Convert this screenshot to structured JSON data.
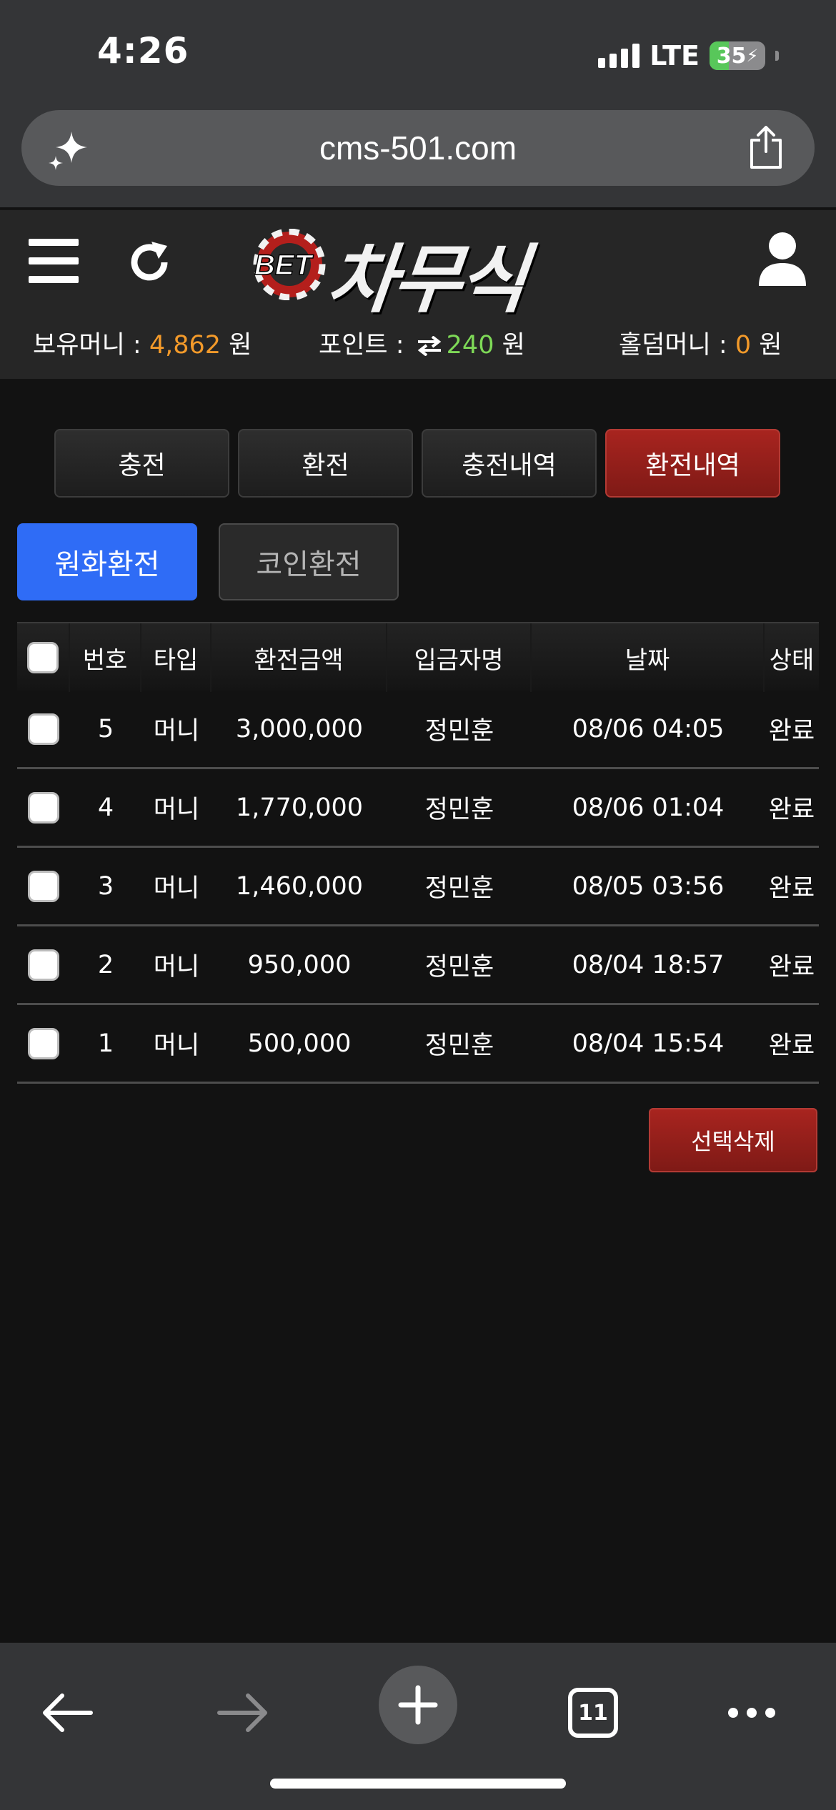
{
  "status_bar": {
    "time": "4:26",
    "network": "LTE",
    "battery": "35",
    "battery_level": 0.35
  },
  "browser": {
    "url": "cms-501.com",
    "tab_count": "11"
  },
  "site": {
    "logo_text": "차무식",
    "logo_badge": "BET",
    "balances": {
      "money_label": "보유머니 : ",
      "money_value": "4,862",
      "money_unit": " 원",
      "point_label": "포인트 : ",
      "point_value": "240",
      "point_unit": " 원",
      "hold_label": "홀덤머니 : ",
      "hold_value": "0",
      "hold_unit": " 원"
    }
  },
  "main_tabs": [
    {
      "label": "충전",
      "active": false
    },
    {
      "label": "환전",
      "active": false
    },
    {
      "label": "충전내역",
      "active": false
    },
    {
      "label": "환전내역",
      "active": true
    }
  ],
  "sub_tabs": {
    "won": "원화환전",
    "coin": "코인환전"
  },
  "table": {
    "headers": [
      "번호",
      "타입",
      "환전금액",
      "입금자명",
      "날짜",
      "상태"
    ],
    "rows": [
      [
        "5",
        "머니",
        "3,000,000",
        "정민훈",
        "08/06 04:05",
        "완료"
      ],
      [
        "4",
        "머니",
        "1,770,000",
        "정민훈",
        "08/06 01:04",
        "완료"
      ],
      [
        "3",
        "머니",
        "1,460,000",
        "정민훈",
        "08/05 03:56",
        "완료"
      ],
      [
        "2",
        "머니",
        "950,000",
        "정민훈",
        "08/04 18:57",
        "완료"
      ],
      [
        "1",
        "머니",
        "500,000",
        "정민훈",
        "08/04 15:54",
        "완료"
      ]
    ]
  },
  "delete_button": "선택삭제",
  "colors": {
    "accent_red": "#9a211c",
    "accent_blue": "#2f6cf6",
    "money_orange": "#f39a2a",
    "point_green": "#7ed957"
  }
}
